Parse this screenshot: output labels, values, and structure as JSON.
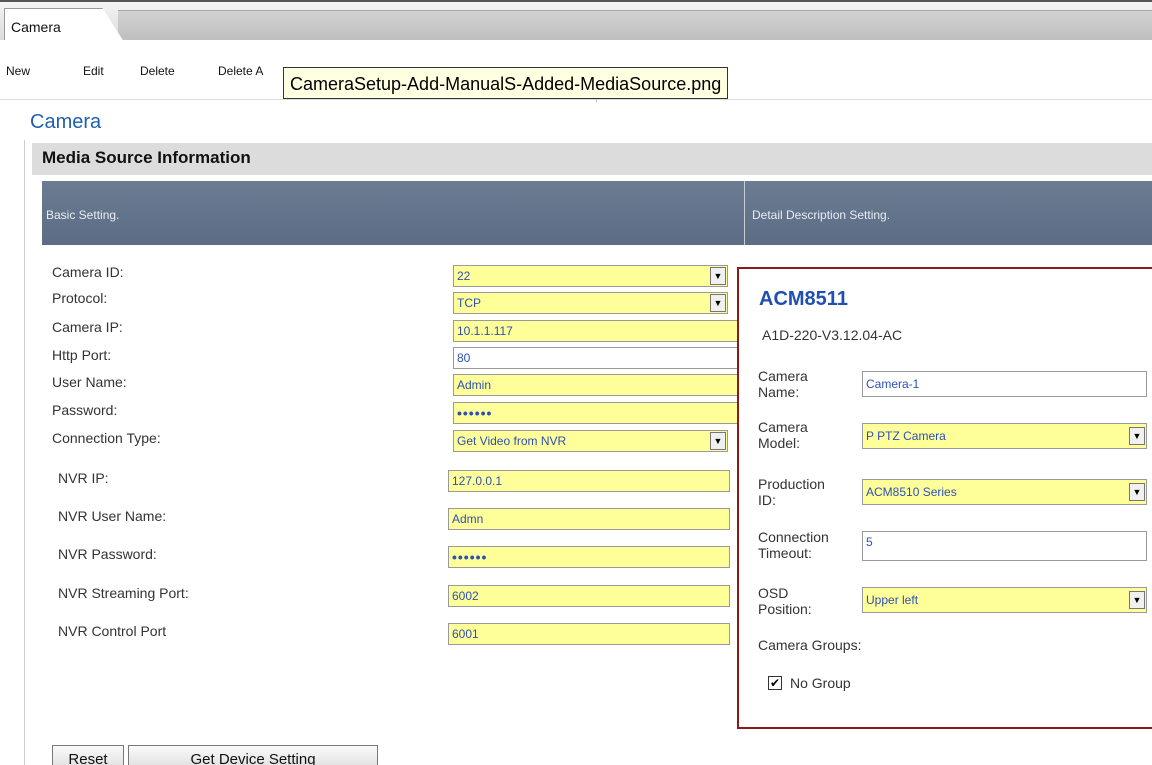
{
  "tabs": [
    {
      "label": "Camera"
    }
  ],
  "toolbar": {
    "new_label": "New",
    "edit_label": "Edit",
    "delete_label": "Delete",
    "delete_all_label": "Delete A"
  },
  "tooltip": {
    "text": "CameraSetup-Add-ManualS-Added-MediaSource.png"
  },
  "page": {
    "title": "Camera"
  },
  "section": {
    "title": "Media Source Information"
  },
  "grid_header": {
    "left": "Basic Setting.",
    "right": "Detail Description Setting."
  },
  "basic": {
    "camera_id": {
      "label": "Camera ID:",
      "value": "22"
    },
    "protocol": {
      "label": "Protocol:",
      "value": "TCP"
    },
    "camera_ip": {
      "label": "Camera IP:",
      "value": "10.1.1.117"
    },
    "http_port": {
      "label": "Http Port:",
      "value": "80"
    },
    "user_name": {
      "label": "User Name:",
      "value": "Admin"
    },
    "password": {
      "label": "Password:",
      "value": "••••••"
    },
    "connection_type": {
      "label": "Connection Type:",
      "value": "Get Video from NVR"
    },
    "nvr_ip": {
      "label": "NVR IP:",
      "value": "127.0.0.1"
    },
    "nvr_user": {
      "label": "NVR User Name:",
      "value": "Admn"
    },
    "nvr_password": {
      "label": "NVR Password:",
      "value": "••••••"
    },
    "nvr_streaming_port": {
      "label": "NVR Streaming Port:",
      "value": "6002"
    },
    "nvr_control_port": {
      "label": "NVR Control Port",
      "value": "6001"
    }
  },
  "detail": {
    "model": "ACM8511",
    "firmware": "A1D-220-V3.12.04-AC",
    "camera_name": {
      "label_1": "Camera",
      "label_2": "Name:",
      "value": "Camera-1"
    },
    "camera_model": {
      "label_1": "Camera",
      "label_2": "Model:",
      "value": "P PTZ Camera"
    },
    "production_id": {
      "label_1": "Production",
      "label_2": "ID:",
      "value": "ACM8510 Series"
    },
    "connection_timeout": {
      "label_1": "Connection",
      "label_2": "Timeout:",
      "value": "5"
    },
    "osd_position": {
      "label_1": "OSD",
      "label_2": "Position:",
      "value": "Upper left"
    },
    "camera_groups_label": "Camera Groups:",
    "no_group": {
      "label": "No Group",
      "checked": true
    }
  },
  "buttons": {
    "reset": "Reset",
    "get_device_setting": "Get Device Setting"
  },
  "colors": {
    "field_highlight": "#ffff99",
    "title_blue": "#1f5fb0",
    "header_slate": "#5b6c84",
    "detail_border": "#8b1a1a"
  },
  "icons": {
    "dropdown": "chevron-down-icon",
    "checkbox": "checkmark-icon"
  }
}
